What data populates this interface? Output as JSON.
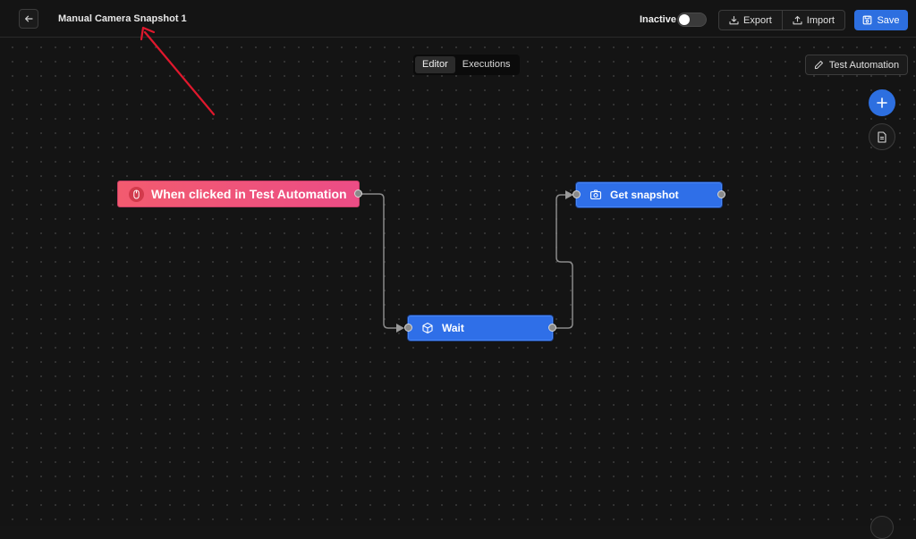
{
  "header": {
    "title": "Manual Camera Snapshot 1",
    "status_label": "Inactive",
    "active": false,
    "export_label": "Export",
    "import_label": "Import",
    "save_label": "Save"
  },
  "canvas": {
    "tabs": [
      {
        "label": "Editor",
        "active": true
      },
      {
        "label": "Executions",
        "active": false
      }
    ],
    "test_button_label": "Test Automation"
  },
  "nodes": {
    "trigger": {
      "label": "When clicked in Test Automation",
      "icon": "mouse-icon"
    },
    "wait": {
      "label": "Wait",
      "icon": "cube-icon"
    },
    "snapshot": {
      "label": "Get snapshot",
      "icon": "camera-icon"
    }
  },
  "colors": {
    "accent": "#2d6fe0",
    "node_blue": "#2f6fe8",
    "trigger_start": "#f25b6f",
    "trigger_end": "#ec4d86",
    "annotation_arrow": "#e0182d"
  }
}
